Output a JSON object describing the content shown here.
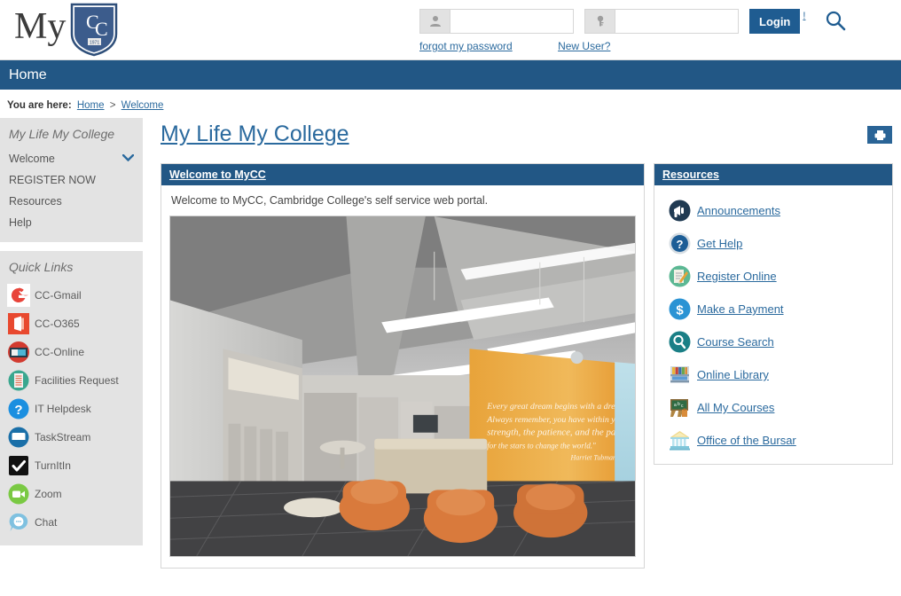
{
  "header": {
    "logo_text": "My",
    "logo_shield_letters": "CC",
    "logo_shield_year": "1971",
    "username_placeholder": "",
    "username_value": "",
    "password_placeholder": "",
    "password_value": "",
    "login_label": "Login",
    "alert_mark": "!",
    "forgot_link": "forgot my password",
    "new_user_link": "New User?",
    "search_icon": "search-icon",
    "user_icon": "user-icon",
    "key_icon": "key-icon"
  },
  "navbar": {
    "items": [
      {
        "label": "Home"
      }
    ]
  },
  "breadcrumb": {
    "label": "You are here:",
    "items": [
      {
        "label": "Home"
      },
      {
        "label": "Welcome"
      }
    ],
    "separator": ">"
  },
  "sidebar": {
    "menu_title": "My Life My College",
    "menu_items": [
      {
        "label": "Welcome",
        "icon": "chevron-down-icon",
        "expandable": true
      },
      {
        "label": "REGISTER NOW",
        "expandable": false
      },
      {
        "label": "Resources",
        "expandable": false
      },
      {
        "label": "Help",
        "expandable": false
      }
    ],
    "quick_links_title": "Quick Links",
    "quick_links": [
      {
        "label": "CC-Gmail",
        "icon": "gmail-icon",
        "color": "#e8443a"
      },
      {
        "label": "CC-O365",
        "icon": "office365-icon",
        "color": "#e8492f"
      },
      {
        "label": "CC-Online",
        "icon": "cc-online-icon",
        "color": "#d23b30"
      },
      {
        "label": "Facilities Request",
        "icon": "facilities-request-icon",
        "color": "#3aa78f"
      },
      {
        "label": "IT Helpdesk",
        "icon": "it-helpdesk-icon",
        "color": "#1b8fe0"
      },
      {
        "label": "TaskStream",
        "icon": "taskstream-icon",
        "color": "#1a6fa8"
      },
      {
        "label": "TurnItIn",
        "icon": "turnitin-icon",
        "color": "#111111"
      },
      {
        "label": "Zoom",
        "icon": "zoom-icon",
        "color": "#7ac943"
      },
      {
        "label": "Chat",
        "icon": "chat-icon",
        "color": "#7fc1e0"
      }
    ]
  },
  "main": {
    "page_title": "My Life My College",
    "tool_button_icon": "printer-icon",
    "welcome_portlet": {
      "title": "Welcome to MyCC",
      "body": "Welcome to MyCC, Cambridge College's self service web portal.",
      "image_alt": "college-interior-photo",
      "image_quote": "Every great dream begins with a dreamer. Always remember, you have within you the strength, the patience, and the passion to reach for the stars to change the world.",
      "image_quote_author": "Harriet Tubman"
    },
    "resources_portlet": {
      "title": "Resources",
      "items": [
        {
          "label": "Announcements",
          "icon": "megaphone-icon"
        },
        {
          "label": "Get Help",
          "icon": "question-circle-icon"
        },
        {
          "label": "Register Online",
          "icon": "register-pencil-icon"
        },
        {
          "label": "Make a Payment",
          "icon": "dollar-circle-icon"
        },
        {
          "label": "Course Search",
          "icon": "magnifier-circle-icon"
        },
        {
          "label": "Online Library",
          "icon": "bookshelf-icon"
        },
        {
          "label": "All My Courses",
          "icon": "chalkboard-icon"
        },
        {
          "label": "Office of the Bursar",
          "icon": "bank-building-icon"
        }
      ]
    }
  },
  "colors": {
    "brand_blue": "#225785",
    "link_blue": "#2b6a9e",
    "sidebar_gray": "#e3e3e3"
  }
}
